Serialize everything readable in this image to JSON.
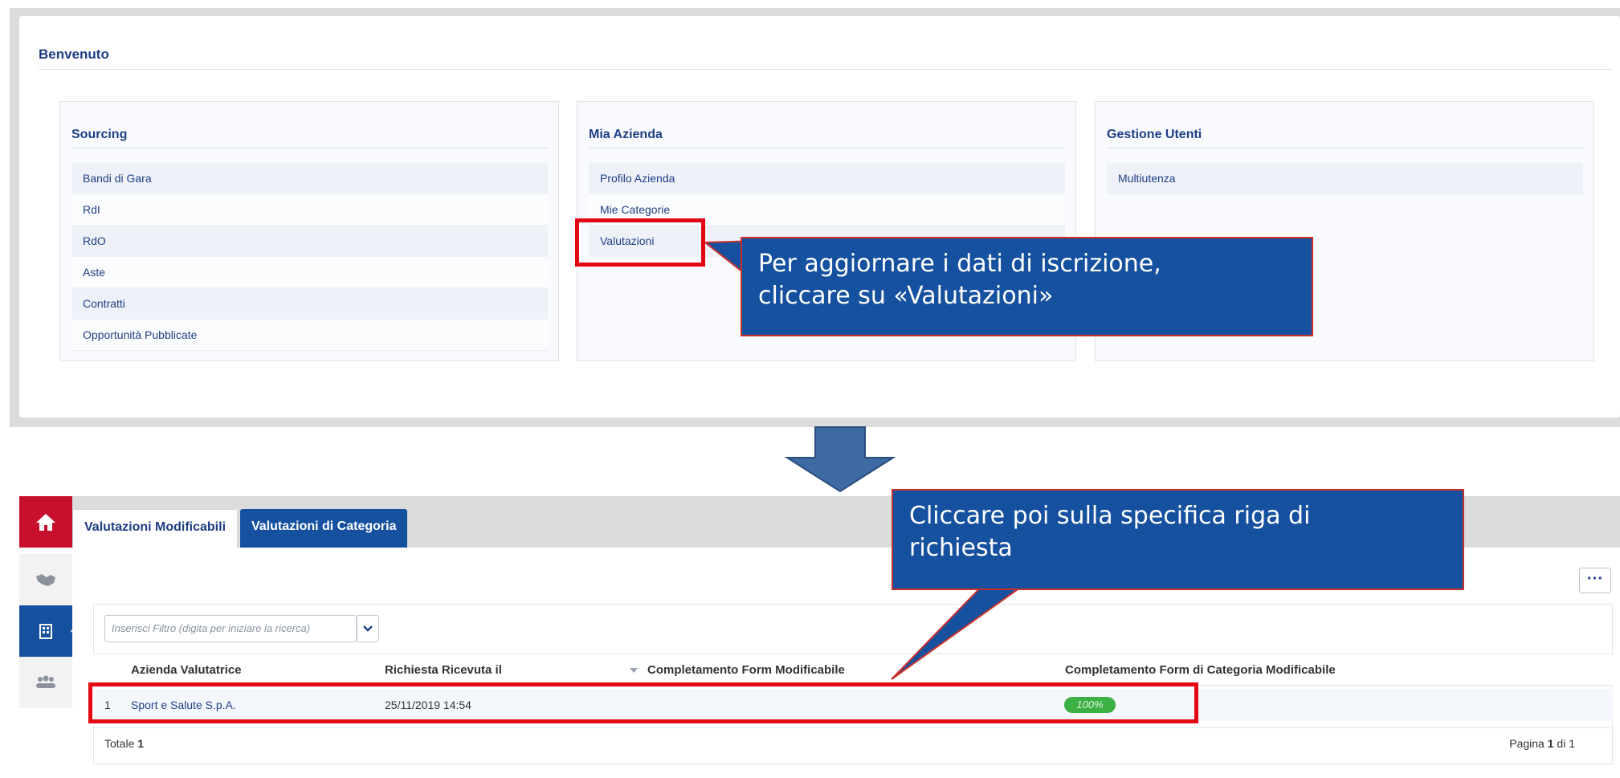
{
  "welcome": {
    "title": "Benvenuto"
  },
  "cards": [
    {
      "title": "Sourcing",
      "items": [
        "Bandi di Gara",
        "RdI",
        "RdO",
        "Aste",
        "Contratti",
        "Opportunità Pubblicate"
      ]
    },
    {
      "title": "Mia Azienda",
      "items": [
        "Profilo Azienda",
        "Mie Categorie",
        "Valutazioni"
      ]
    },
    {
      "title": "Gestione Utenti",
      "items": [
        "Multiutenza"
      ]
    }
  ],
  "callouts": {
    "first_line1": "Per aggiornare i dati di iscrizione,",
    "first_line2": "cliccare su «Valutazioni»",
    "second_line1": "Cliccare poi sulla specifica riga di",
    "second_line2": "richiesta"
  },
  "tabs": {
    "active": "Valutazioni Modificabili",
    "other": "Valutazioni di Categoria"
  },
  "toolbar": {
    "more": "···"
  },
  "filter": {
    "placeholder": "Inserisci Filtro (digita per iniziare la ricerca)"
  },
  "table": {
    "columns": [
      "Azienda Valutatrice",
      "Richiesta Ricevuta il",
      "Completamento Form Modificabile",
      "Completamento Form di Categoria Modificabile"
    ],
    "rows": [
      {
        "index": "1",
        "azienda": "Sport e Salute S.p.A.",
        "ricevuta": "25/11/2019 14:54",
        "completamento_categoria": "100%"
      }
    ],
    "footer": {
      "total_label": "Totale",
      "total_value": "1",
      "pagina_label": "Pagina",
      "pagina_current": "1",
      "pagina_of": "di 1"
    }
  },
  "colors": {
    "brand_blue": "#1651a0",
    "highlight_red": "#e30613",
    "success_green": "#3cb043",
    "home_red": "#c8102e"
  },
  "icons": [
    "home-icon",
    "handshake-icon",
    "building-icon",
    "users-icon",
    "chevron-down-icon",
    "down-arrow-icon"
  ]
}
